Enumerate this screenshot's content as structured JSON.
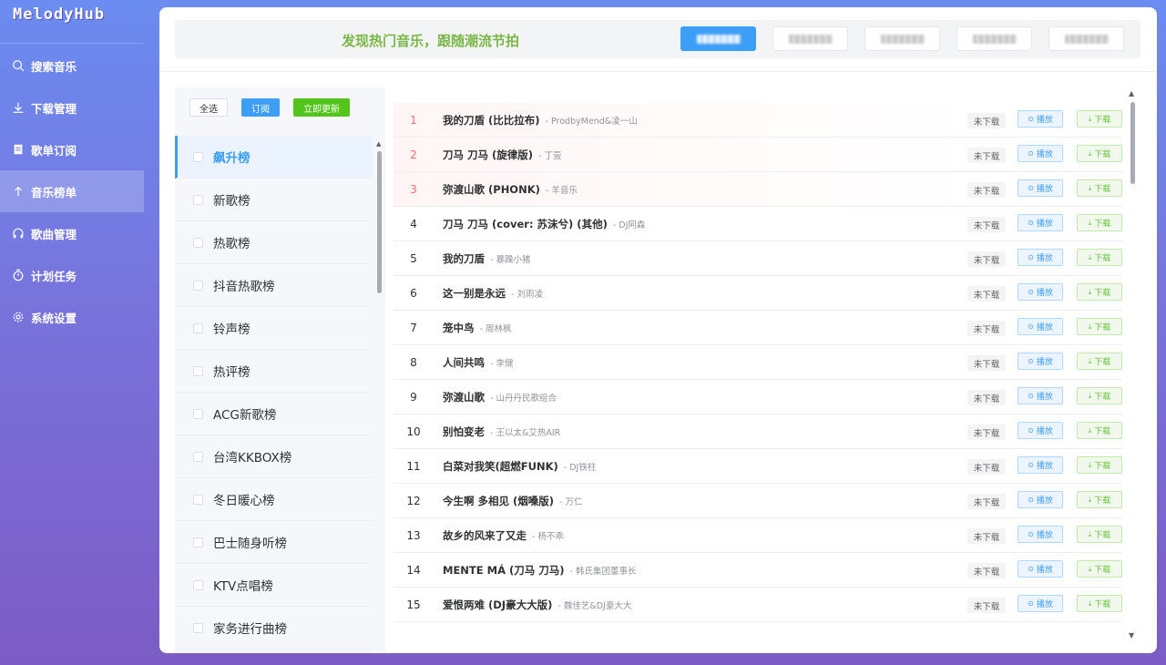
{
  "app": {
    "logo": "MelodyHub"
  },
  "sidebar": {
    "items": [
      {
        "label": "搜索音乐",
        "icon": "search-icon"
      },
      {
        "label": "下载管理",
        "icon": "download-icon"
      },
      {
        "label": "歌单订阅",
        "icon": "clipboard-icon"
      },
      {
        "label": "音乐榜单",
        "icon": "arrow-up-icon",
        "active": true
      },
      {
        "label": "歌曲管理",
        "icon": "headphones-icon"
      },
      {
        "label": "计划任务",
        "icon": "timer-icon"
      },
      {
        "label": "系统设置",
        "icon": "gear-icon"
      }
    ]
  },
  "header": {
    "slogan": "发现热门音乐，跟随潮流节拍"
  },
  "toolbar": {
    "select_all": "全选",
    "subscribe": "订阅",
    "update_now": "立即更新"
  },
  "charts": [
    {
      "label": "飙升榜",
      "active": true
    },
    {
      "label": "新歌榜"
    },
    {
      "label": "热歌榜"
    },
    {
      "label": "抖音热歌榜"
    },
    {
      "label": "铃声榜"
    },
    {
      "label": "热评榜"
    },
    {
      "label": "ACG新歌榜"
    },
    {
      "label": "台湾KKBOX榜"
    },
    {
      "label": "冬日暖心榜"
    },
    {
      "label": "巴士随身听榜"
    },
    {
      "label": "KTV点唱榜"
    },
    {
      "label": "家务进行曲榜"
    }
  ],
  "song_actions": {
    "status": "未下载",
    "play": "播放",
    "download": "下载"
  },
  "songs": [
    {
      "rank": "1",
      "title": "我的刀盾 (比比拉布)",
      "artist": "- ProdbyMend&凌一山"
    },
    {
      "rank": "2",
      "title": "刀马 刀马 (旋律版)",
      "artist": "- 丁壹"
    },
    {
      "rank": "3",
      "title": "弥渡山歌 (PHONK)",
      "artist": "- 羊音乐"
    },
    {
      "rank": "4",
      "title": "刀马 刀马 (cover: 苏沫兮) (其他)",
      "artist": "- DJ阿森"
    },
    {
      "rank": "5",
      "title": "我的刀盾",
      "artist": "- 暴躁小猪"
    },
    {
      "rank": "6",
      "title": "这一别是永远",
      "artist": "- 刘雨凌"
    },
    {
      "rank": "7",
      "title": "笼中鸟",
      "artist": "- 周林枫"
    },
    {
      "rank": "8",
      "title": "人间共鸣",
      "artist": "- 李健"
    },
    {
      "rank": "9",
      "title": "弥渡山歌",
      "artist": "- 山丹丹民歌组合"
    },
    {
      "rank": "10",
      "title": "别怕变老",
      "artist": "- 王以太&艾热AIR"
    },
    {
      "rank": "11",
      "title": "白菜对我笑(超燃FUNK)",
      "artist": "- DJ铁柱"
    },
    {
      "rank": "12",
      "title": "今生啊 多相见 (烟嗓版)",
      "artist": "- 万仁"
    },
    {
      "rank": "13",
      "title": "故乡的风来了又走",
      "artist": "- 杨不乖"
    },
    {
      "rank": "14",
      "title": "MENTE MÁ (刀马 刀马)",
      "artist": "- 韩氏集团董事长"
    },
    {
      "rank": "15",
      "title": "爱恨两难 (DJ豪大大版)",
      "artist": "- 魏佳艺&DJ豪大大"
    }
  ],
  "colors": {
    "accent": "#3d9ef5",
    "hot_rank": "#f56c6c",
    "slogan": "#7ab648",
    "update_button": "#52c41a"
  }
}
